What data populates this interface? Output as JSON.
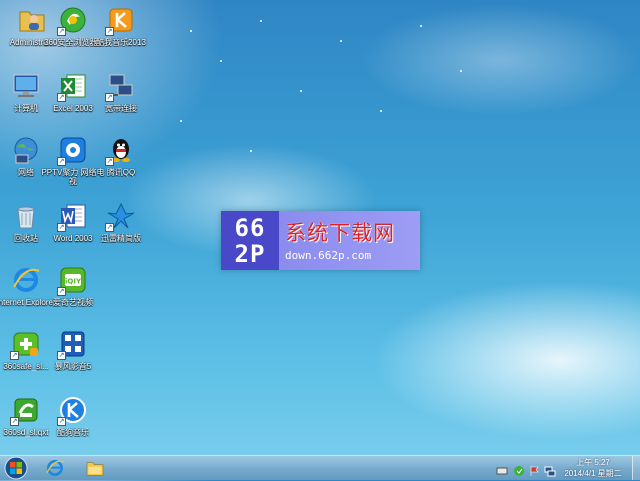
{
  "desktop_icons": [
    {
      "label": "Administra...",
      "icon": "folder-user-icon"
    },
    {
      "label": "360安全浏览器6",
      "icon": "360-browser-icon"
    },
    {
      "label": "酷我音乐2013",
      "icon": "kuwo-music-icon"
    },
    {
      "label": "计算机",
      "icon": "computer-icon"
    },
    {
      "label": "Excel 2003",
      "icon": "excel-icon"
    },
    {
      "label": "宽带连接",
      "icon": "broadband-icon"
    },
    {
      "label": "网络",
      "icon": "network-icon"
    },
    {
      "label": "PPTV聚力 网络电视",
      "icon": "pptv-icon"
    },
    {
      "label": "腾讯QQ",
      "icon": "qq-icon"
    },
    {
      "label": "回收站",
      "icon": "recycle-bin-icon"
    },
    {
      "label": "Word 2003",
      "icon": "word-icon"
    },
    {
      "label": "迅雷精简版",
      "icon": "xunlei-icon"
    },
    {
      "label": "Internet Explorer",
      "icon": "ie-icon"
    },
    {
      "label": "爱奇艺视频",
      "icon": "iqiyi-icon"
    },
    {
      "label": "360safe_sl...",
      "icon": "360safe-icon"
    },
    {
      "label": "暴风影音5",
      "icon": "baofeng-icon"
    },
    {
      "label": "360sd_sl.qxt",
      "icon": "360sd-icon"
    },
    {
      "label": "酷狗音乐",
      "icon": "kugou-icon"
    }
  ],
  "watermark": {
    "logo_top": "66",
    "logo_bottom": "2P",
    "title": "系统下载网",
    "url": "down.662p.com"
  },
  "taskbar": {
    "start_icon": "windows-start-icon",
    "pinned": [
      "ie-icon",
      "explorer-folder-icon"
    ],
    "tray_icons": [
      "keyboard-icon",
      "security-shield-icon",
      "flag-icon",
      "network-tray-icon"
    ],
    "clock_time": "上午 5:27",
    "clock_date": "2014/4/1 星期二"
  },
  "colors": {
    "accent": "#2f86c4",
    "watermark_bg": "#6a6ae0",
    "watermark_title": "#e02020"
  }
}
